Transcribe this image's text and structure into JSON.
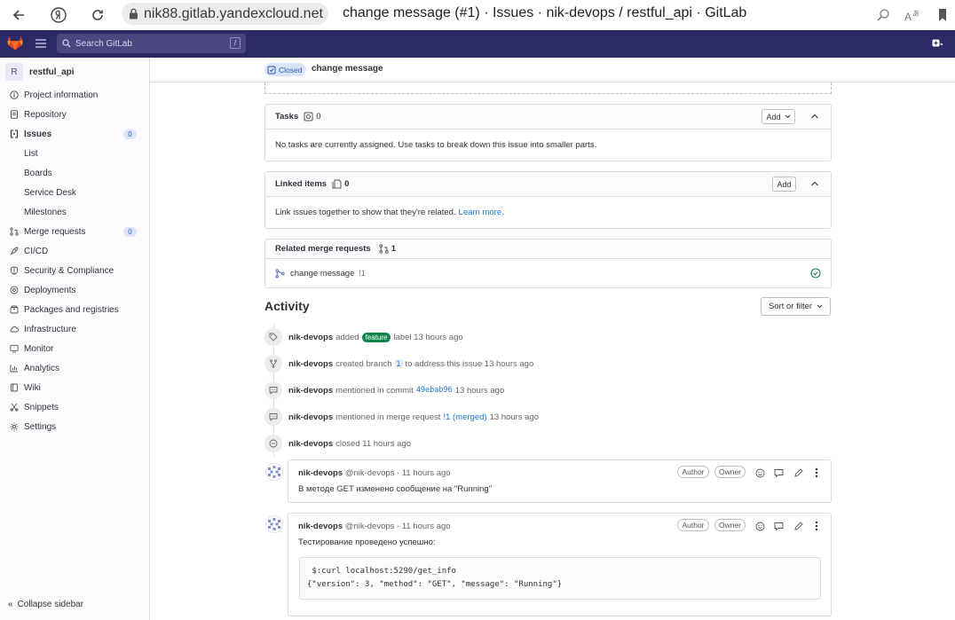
{
  "browser": {
    "domain": "nik88.gitlab.yandexcloud.net",
    "page_title": "change message (#1) · Issues · nik-devops / restful_api · GitLab"
  },
  "header": {
    "search_placeholder": "Search GitLab",
    "search_shortcut": "/"
  },
  "sidebar": {
    "project_avatar": "R",
    "project_name": "restful_api",
    "items": [
      {
        "label": "Project information",
        "icon": "info-icon"
      },
      {
        "label": "Repository",
        "icon": "doc-icon"
      },
      {
        "label": "Issues",
        "icon": "issues-icon",
        "count": "0"
      },
      {
        "label": "List"
      },
      {
        "label": "Boards"
      },
      {
        "label": "Service Desk"
      },
      {
        "label": "Milestones"
      },
      {
        "label": "Merge requests",
        "icon": "merge-request-icon",
        "count": "0"
      },
      {
        "label": "CI/CD",
        "icon": "rocket-icon"
      },
      {
        "label": "Security & Compliance",
        "icon": "shield-icon"
      },
      {
        "label": "Deployments",
        "icon": "deployments-icon"
      },
      {
        "label": "Packages and registries",
        "icon": "package-icon"
      },
      {
        "label": "Infrastructure",
        "icon": "cloud-icon"
      },
      {
        "label": "Monitor",
        "icon": "monitor-icon"
      },
      {
        "label": "Analytics",
        "icon": "chart-icon"
      },
      {
        "label": "Wiki",
        "icon": "book-icon"
      },
      {
        "label": "Snippets",
        "icon": "snippet-icon"
      },
      {
        "label": "Settings",
        "icon": "gear-icon"
      }
    ],
    "collapse_label": "Collapse sidebar"
  },
  "issue": {
    "status": "Closed",
    "title": "change message"
  },
  "tasks": {
    "title": "Tasks",
    "count": "0",
    "add_label": "Add",
    "empty_text": "No tasks are currently assigned. Use tasks to break down this issue into smaller parts."
  },
  "linked": {
    "title": "Linked items",
    "count": "0",
    "add_label": "Add",
    "text": "Link issues together to show that they're related.",
    "learn_more": "Learn more."
  },
  "related_mr": {
    "title": "Related merge requests",
    "count": "1",
    "item_title": "change message",
    "item_ref": "!1"
  },
  "activity": {
    "title": "Activity",
    "sort_label": "Sort or filter",
    "events": [
      {
        "author": "nik-devops",
        "pre": "added",
        "label": "feature",
        "post": "label 13 hours ago"
      },
      {
        "author": "nik-devops",
        "pre": "created branch",
        "branch": "1",
        "post": "to address this issue 13 hours ago"
      },
      {
        "author": "nik-devops",
        "pre": "mentioned in commit",
        "link": "49ebab96",
        "post": "13 hours ago"
      },
      {
        "author": "nik-devops",
        "pre": "mentioned in merge request",
        "link": "!1 (merged)",
        "post": "13 hours ago"
      },
      {
        "author": "nik-devops",
        "pre": "closed 11 hours ago"
      }
    ],
    "comments": [
      {
        "author": "nik-devops",
        "handle": "@nik-devops · 11 hours ago",
        "badge_author": "Author",
        "badge_owner": "Owner",
        "text": "В методе GET изменено сообщение на \"Running\""
      },
      {
        "author": "nik-devops",
        "handle": "@nik-devops · 11 hours ago",
        "badge_author": "Author",
        "badge_owner": "Owner",
        "text": "Тестирование проведено успешно:",
        "code_line1": " $:curl localhost:5290/get_info",
        "code_line2": "{\"version\": 3, \"method\": \"GET\", \"message\": \"Running\"}"
      }
    ]
  }
}
